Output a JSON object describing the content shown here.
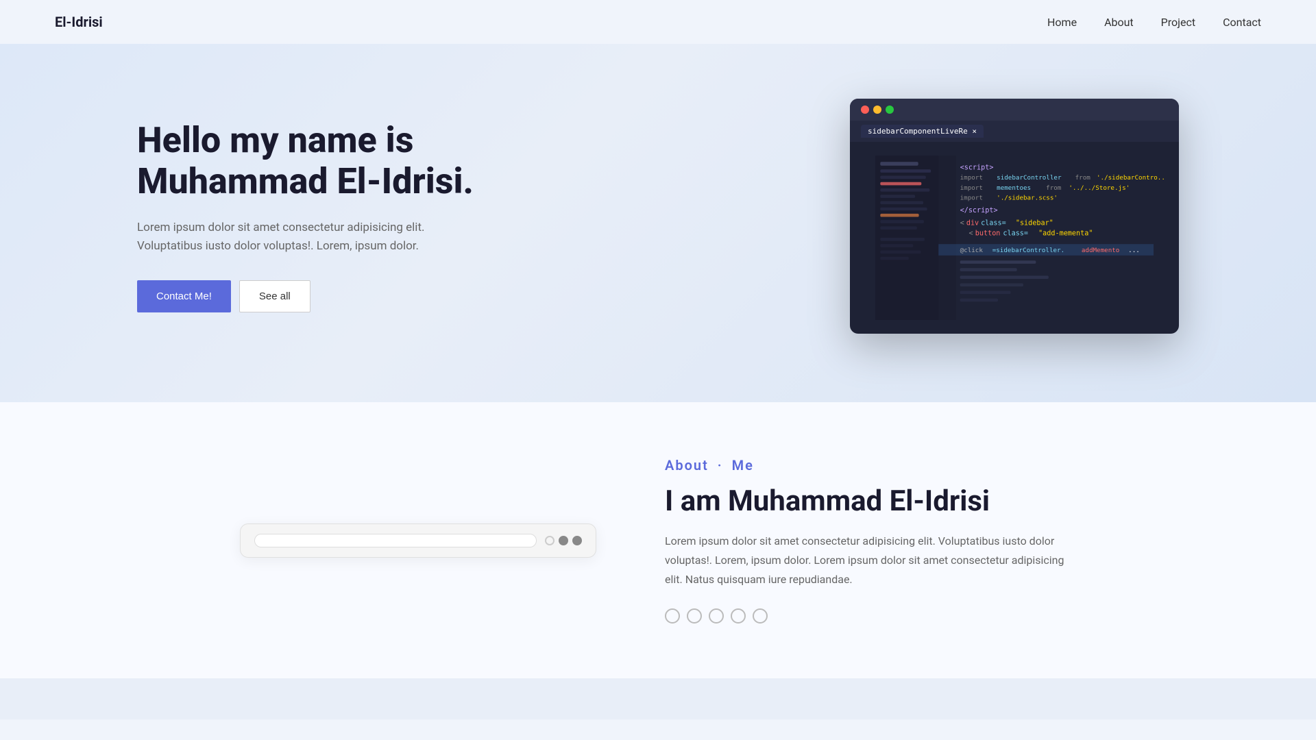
{
  "brand": "El-Idrisi",
  "nav": {
    "links": [
      {
        "label": "Home",
        "href": "#"
      },
      {
        "label": "About",
        "href": "#"
      },
      {
        "label": "Project",
        "href": "#"
      },
      {
        "label": "Contact",
        "href": "#"
      }
    ]
  },
  "hero": {
    "title": "Hello my name is Muhammad El-Idrisi.",
    "description": "Lorem ipsum dolor sit amet consectetur adipisicing elit. Voluptatibus iusto dolor voluptas!. Lorem, ipsum dolor.",
    "contact_button": "Contact Me!",
    "see_all_button": "See all"
  },
  "code_window": {
    "tab_label": "sidebarComponentLiveRe ×"
  },
  "about": {
    "label_part1": "About",
    "dot": "·",
    "label_part2": "Me",
    "title": "I am Muhammad El-Idrisi",
    "description": "Lorem ipsum dolor sit amet consectetur adipisicing elit. Voluptatibus iusto dolor voluptas!. Lorem, ipsum dolor. Lorem ipsum dolor sit amet consectetur adipisicing elit. Natus quisquam iure repudiandae.",
    "skill_dots_count": 5
  }
}
